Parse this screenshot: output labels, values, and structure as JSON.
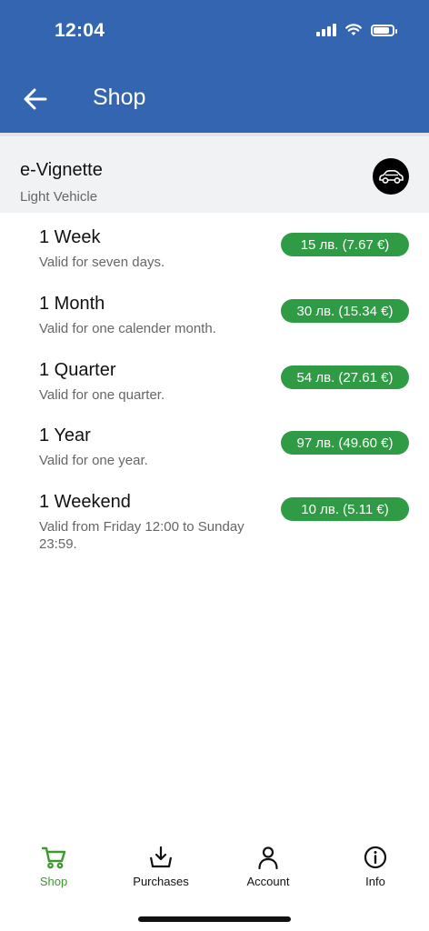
{
  "status_bar": {
    "time": "12:04"
  },
  "header": {
    "title": "Shop"
  },
  "category": {
    "title": "e-Vignette",
    "subtitle": "Light Vehicle"
  },
  "products": [
    {
      "name": "1 Week",
      "description": "Valid for seven days.",
      "price": "15 лв. (7.67 €)"
    },
    {
      "name": "1 Month",
      "description": "Valid for one calender month.",
      "price": "30 лв. (15.34 €)"
    },
    {
      "name": "1 Quarter",
      "description": "Valid for one quarter.",
      "price": "54 лв. (27.61 €)"
    },
    {
      "name": "1 Year",
      "description": "Valid for one year.",
      "price": "97 лв. (49.60 €)"
    },
    {
      "name": "1 Weekend",
      "description": "Valid from Friday 12:00 to Sunday 23:59.",
      "price": "10 лв. (5.11 €)"
    }
  ],
  "tabs": [
    {
      "label": "Shop",
      "icon": "cart-icon",
      "active": true
    },
    {
      "label": "Purchases",
      "icon": "download-tray-icon",
      "active": false
    },
    {
      "label": "Account",
      "icon": "person-icon",
      "active": false
    },
    {
      "label": "Info",
      "icon": "info-icon",
      "active": false
    }
  ],
  "colors": {
    "header": "#3465b0",
    "price": "#2f9b44",
    "active_tab": "#3a9a2c"
  }
}
